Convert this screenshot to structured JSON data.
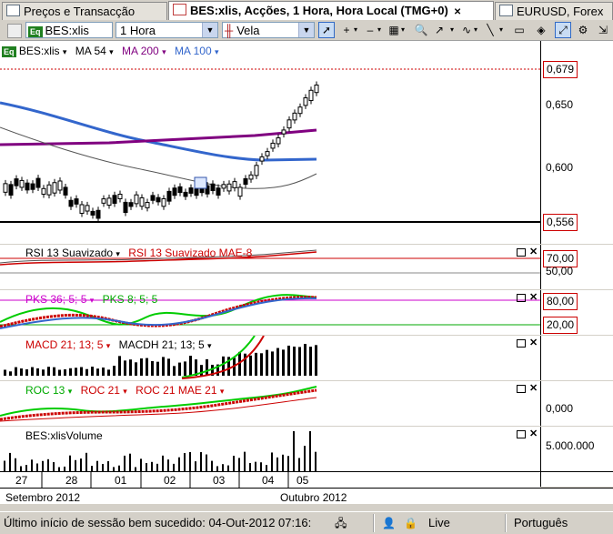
{
  "tabs": [
    {
      "label": "Preços e Transacção",
      "active": false
    },
    {
      "label": "BES:xlis, Acções, 1 Hora, Hora Local (TMG+0)",
      "active": true
    },
    {
      "label": "EURUSD, Forex",
      "active": false
    }
  ],
  "tab_close": "✕",
  "toolbar": {
    "symbol": "BES:xlis",
    "timeframe": "1 Hora",
    "chart_type": "Vela"
  },
  "main_chart": {
    "legend": {
      "symbol": "BES:xlis",
      "ma54": "MA 54",
      "ma200": "MA 200",
      "ma100": "MA 100"
    },
    "price_labels": [
      "0,679",
      "0,650",
      "0,600",
      "0,556"
    ],
    "colors": {
      "ma54": "#555555",
      "ma200": "#800080",
      "ma100": "#3366cc",
      "candle_up": "#ffffff",
      "candle_down": "#000000",
      "last_line": "#cc0000"
    }
  },
  "rsi_panel": {
    "title": "RSI 13 Suavizado",
    "title2": "RSI 13 Suavizado MAE-8",
    "levels": [
      "70,00",
      "50,00"
    ]
  },
  "pks_panel": {
    "title": "PKS 36; 5; 5",
    "title2": "PKS 8; 5; 5",
    "levels": [
      "80,00",
      "20,00"
    ]
  },
  "macd_panel": {
    "title": "MACD 21; 13; 5",
    "title2": "MACDH 21; 13; 5"
  },
  "roc_panel": {
    "title": "ROC 13",
    "title2": "ROC 21",
    "title3": "ROC 21 MAE 21",
    "levels": [
      "0,000"
    ]
  },
  "volume_panel": {
    "title": "BES:xlisVolume",
    "levels": [
      "5.000.000"
    ]
  },
  "date_axis": {
    "days": [
      "27",
      "28",
      "01",
      "02",
      "03",
      "04",
      "05"
    ],
    "months": [
      "Setembro 2012",
      "Outubro 2012"
    ]
  },
  "status_bar": {
    "message": "Último início de sessão bem sucedido: 04-Out-2012 07:16:",
    "connection": "Live",
    "language": "Português"
  }
}
